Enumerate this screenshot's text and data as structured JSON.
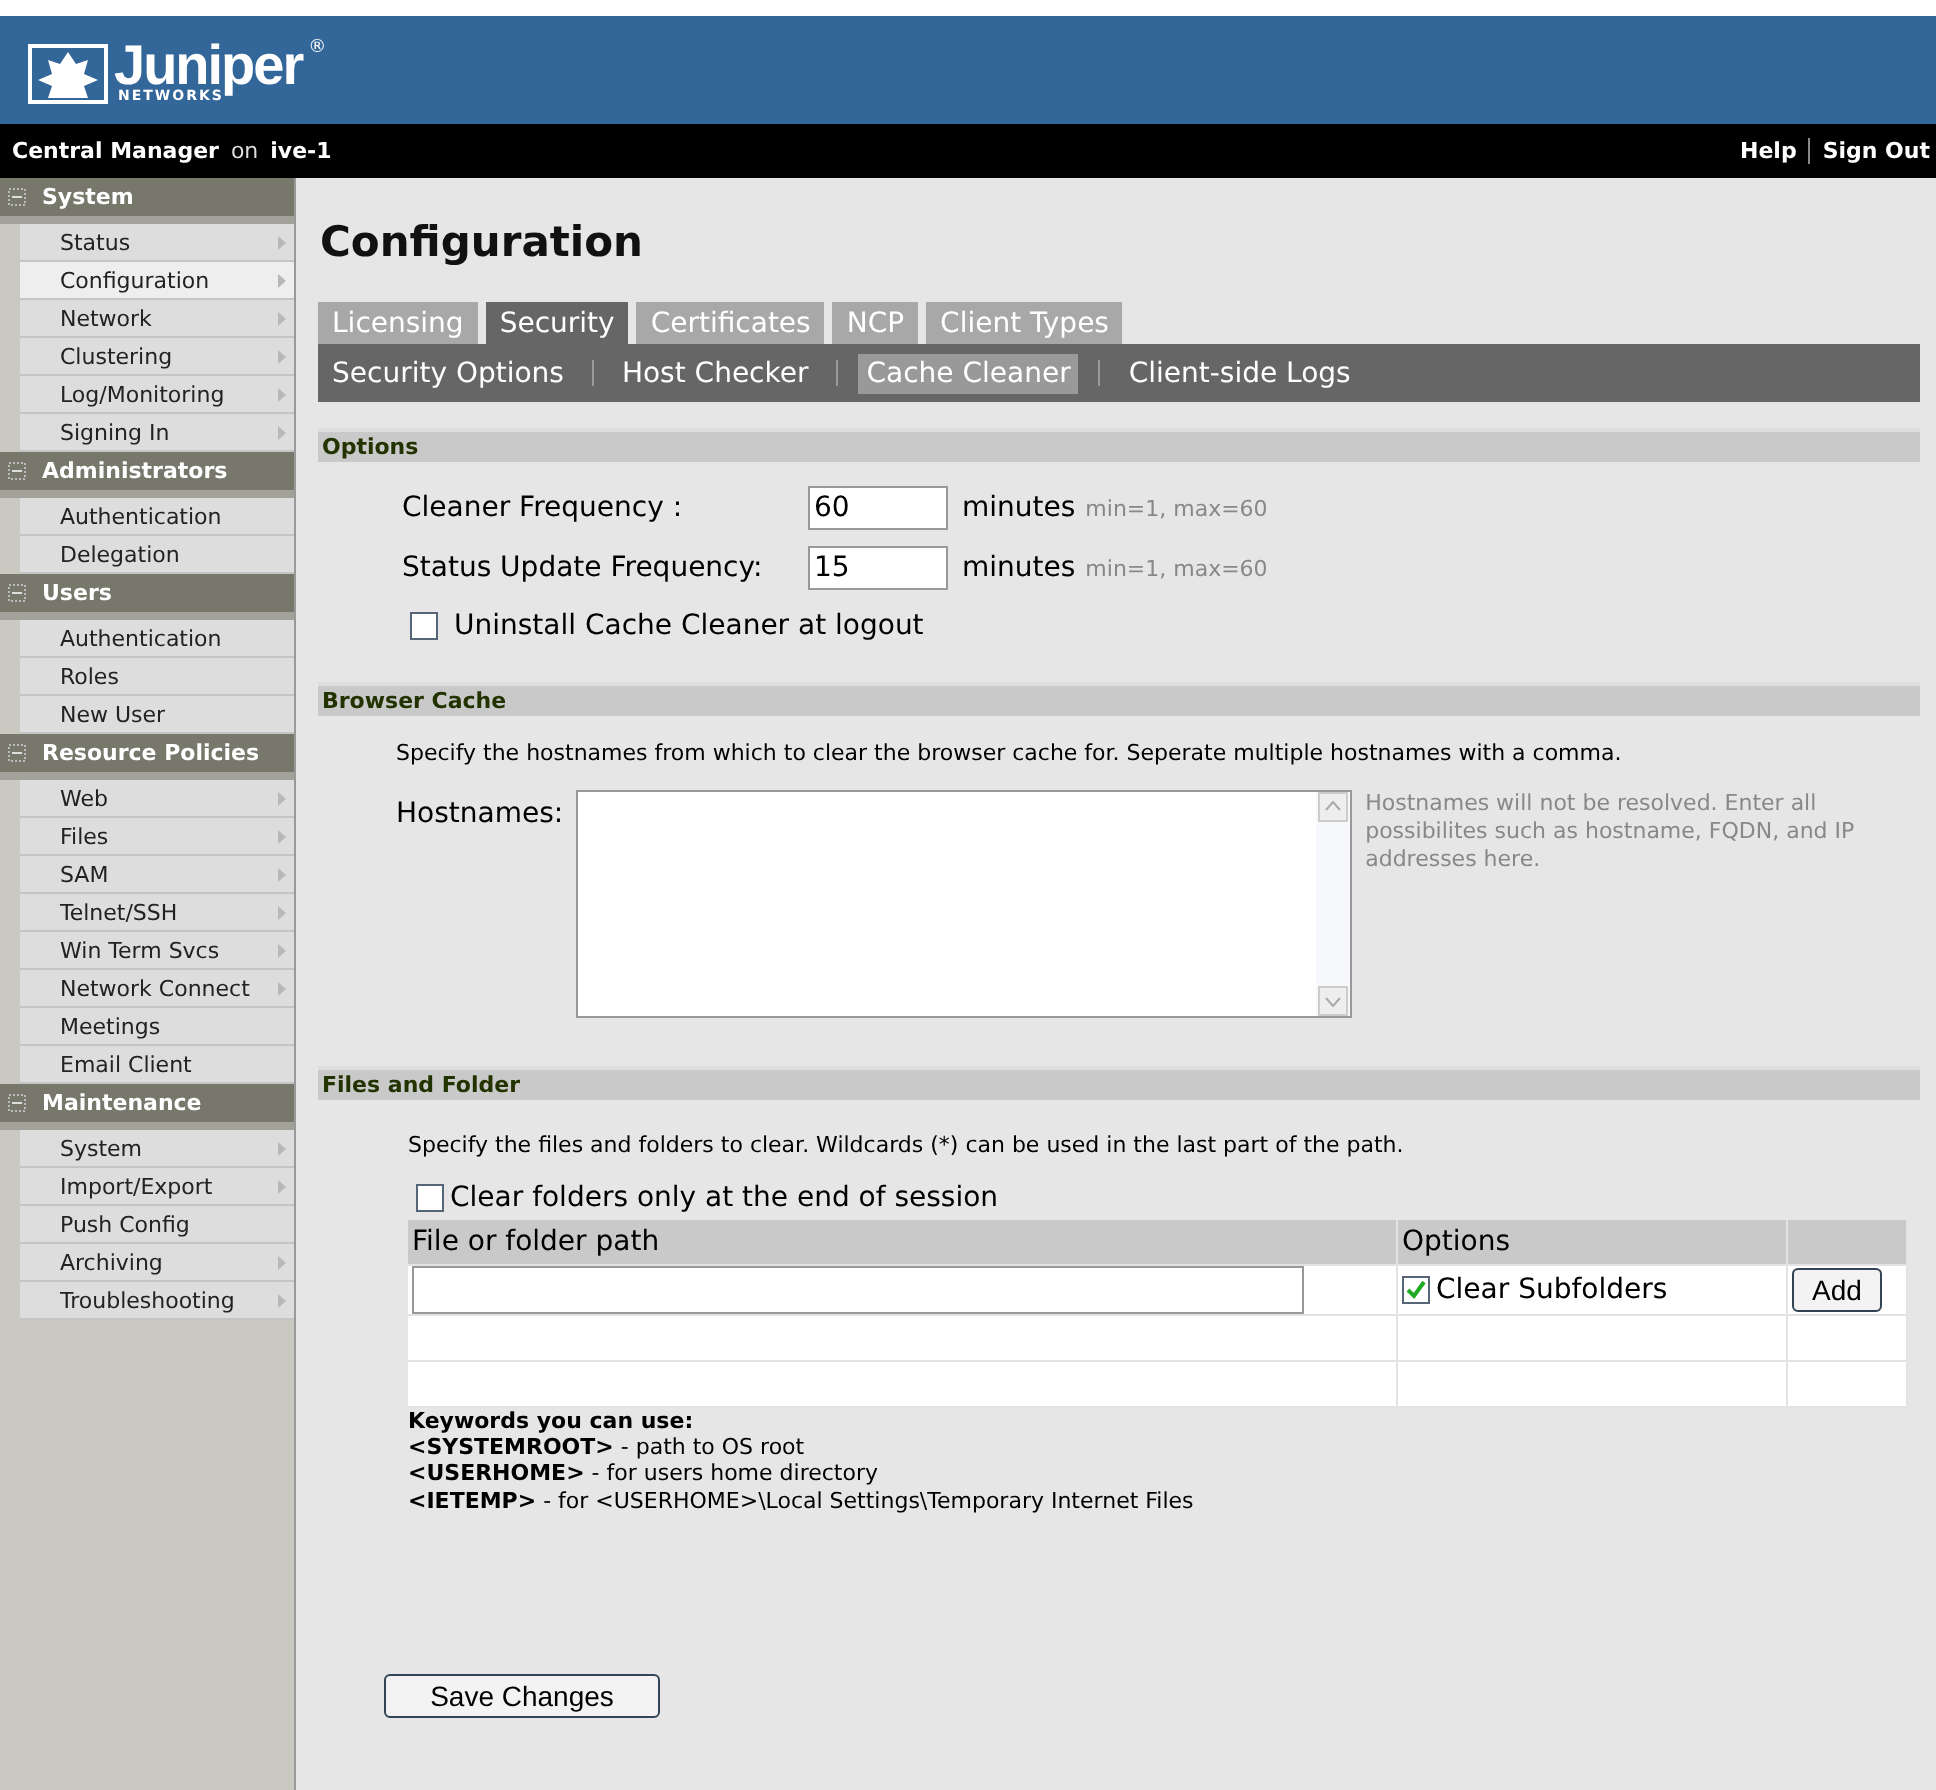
{
  "header": {
    "logo_text": "Juniper",
    "logo_subtext": "NETWORKS",
    "logo_mark": "®"
  },
  "topbar": {
    "product": "Central Manager",
    "on": "on",
    "host": "ive-1",
    "links": [
      "Help",
      "Sign Out"
    ]
  },
  "sidebar": [
    {
      "title": "System",
      "expanded": true,
      "items": [
        {
          "label": "Status",
          "submenu": true,
          "selected": false
        },
        {
          "label": "Configuration",
          "submenu": true,
          "selected": true
        },
        {
          "label": "Network",
          "submenu": true,
          "selected": false
        },
        {
          "label": "Clustering",
          "submenu": true,
          "selected": false
        },
        {
          "label": "Log/Monitoring",
          "submenu": true,
          "selected": false
        },
        {
          "label": "Signing In",
          "submenu": true,
          "selected": false
        }
      ]
    },
    {
      "title": "Administrators",
      "expanded": true,
      "items": [
        {
          "label": "Authentication",
          "submenu": false,
          "selected": false
        },
        {
          "label": "Delegation",
          "submenu": false,
          "selected": false
        }
      ]
    },
    {
      "title": "Users",
      "expanded": true,
      "items": [
        {
          "label": "Authentication",
          "submenu": false,
          "selected": false
        },
        {
          "label": "Roles",
          "submenu": false,
          "selected": false
        },
        {
          "label": "New User",
          "submenu": false,
          "selected": false
        }
      ]
    },
    {
      "title": "Resource Policies",
      "expanded": true,
      "items": [
        {
          "label": "Web",
          "submenu": true,
          "selected": false
        },
        {
          "label": "Files",
          "submenu": true,
          "selected": false
        },
        {
          "label": "SAM",
          "submenu": true,
          "selected": false
        },
        {
          "label": "Telnet/SSH",
          "submenu": true,
          "selected": false
        },
        {
          "label": "Win Term Svcs",
          "submenu": true,
          "selected": false
        },
        {
          "label": "Network Connect",
          "submenu": true,
          "selected": false
        },
        {
          "label": "Meetings",
          "submenu": false,
          "selected": false
        },
        {
          "label": "Email Client",
          "submenu": false,
          "selected": false
        }
      ]
    },
    {
      "title": "Maintenance",
      "expanded": true,
      "items": [
        {
          "label": "System",
          "submenu": true,
          "selected": false
        },
        {
          "label": "Import/Export",
          "submenu": true,
          "selected": false
        },
        {
          "label": "Push Config",
          "submenu": false,
          "selected": false
        },
        {
          "label": "Archiving",
          "submenu": true,
          "selected": false
        },
        {
          "label": "Troubleshooting",
          "submenu": true,
          "selected": false
        }
      ]
    }
  ],
  "page_title": "Configuration",
  "tabs": [
    {
      "label": "Licensing",
      "selected": false
    },
    {
      "label": "Security",
      "selected": true
    },
    {
      "label": "Certificates",
      "selected": false
    },
    {
      "label": "NCP",
      "selected": false
    },
    {
      "label": "Client Types",
      "selected": false
    }
  ],
  "subtabs": [
    {
      "label": "Security Options",
      "selected": false
    },
    {
      "label": "Host Checker",
      "selected": false
    },
    {
      "label": "Cache Cleaner",
      "selected": true
    },
    {
      "label": "Client-side Logs",
      "selected": false
    }
  ],
  "options": {
    "title": "Options",
    "fields": [
      {
        "label": "Cleaner Frequency :",
        "value": "60",
        "unit": "minutes",
        "hint": "min=1, max=60"
      },
      {
        "label": "Status Update Frequency:",
        "value": "15",
        "unit": "minutes",
        "hint": "min=1, max=60"
      }
    ],
    "uninstall": {
      "label": "Uninstall Cache Cleaner at logout",
      "checked": false
    }
  },
  "browser_cache": {
    "title": "Browser Cache",
    "description": "Specify the hostnames from which to clear the browser cache for. Seperate multiple hostnames with a comma.",
    "label": "Hostnames:",
    "help": "Hostnames will not be resolved. Enter all possibilites such as hostname, FQDN, and IP addresses here."
  },
  "files": {
    "title": "Files and Folder",
    "description": "Specify the files and folders to clear. Wildcards (*) can be used in the last part of the path.",
    "end_of_session": {
      "label": "Clear folders only at the end of session",
      "checked": false
    },
    "columns": [
      "File or folder path",
      "Options"
    ],
    "subfolders": {
      "label": "Clear Subfolders",
      "checked": true
    },
    "add_button": "Add",
    "keywords_title": "Keywords you can use:",
    "keywords": [
      "**<SYSTEMROOT>** - path to OS root",
      "**<USERHOME>** - for users home directory",
      "**<IETEMP>** - for <USERHOME>\\Local Settings\\Temporary Internet Files"
    ]
  },
  "save_button": "Save Changes"
}
